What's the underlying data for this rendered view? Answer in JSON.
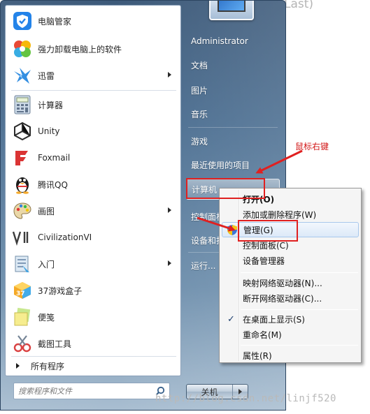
{
  "background_title": "Last)",
  "start_menu": {
    "programs": [
      {
        "label": "电脑管家",
        "icon": "pc-manager-icon",
        "submenu": false
      },
      {
        "label": "强力卸载电脑上的软件",
        "icon": "uninstaller-icon",
        "submenu": false
      },
      {
        "label": "迅雷",
        "icon": "thunder-bird-icon",
        "submenu": true
      },
      {
        "label": "计算器",
        "icon": "calculator-icon",
        "submenu": false
      },
      {
        "label": "Unity",
        "icon": "unity-icon",
        "submenu": false
      },
      {
        "label": "Foxmail",
        "icon": "foxmail-icon",
        "submenu": false
      },
      {
        "label": "腾讯QQ",
        "icon": "qq-penguin-icon",
        "submenu": false
      },
      {
        "label": "画图",
        "icon": "paint-palette-icon",
        "submenu": true
      },
      {
        "label": "CivilizationVI",
        "icon": "civilization-icon",
        "submenu": false
      },
      {
        "label": "入门",
        "icon": "getting-started-icon",
        "submenu": true
      },
      {
        "label": "37游戏盒子",
        "icon": "game-box-icon",
        "submenu": false
      },
      {
        "label": "便笺",
        "icon": "sticky-notes-icon",
        "submenu": false
      },
      {
        "label": "截图工具",
        "icon": "snipping-tool-icon",
        "submenu": false
      }
    ],
    "all_programs": "所有程序",
    "search_placeholder": "搜索程序和文件",
    "right_links": [
      {
        "label": "Administrator"
      },
      {
        "label": "文档"
      },
      {
        "label": "图片"
      },
      {
        "label": "音乐"
      },
      {
        "label": "游戏"
      },
      {
        "label": "最近使用的项目"
      },
      {
        "label": "计算机"
      },
      {
        "label": "控制面板"
      },
      {
        "label": "设备和打印机"
      },
      {
        "label": "运行..."
      }
    ],
    "shutdown_label": "关机"
  },
  "context_menu": {
    "items": [
      {
        "label": "打开(O)",
        "bold": true
      },
      {
        "label": "添加或删除程序(W)"
      },
      {
        "label": "管理(G)",
        "icon": "uac-shield-icon",
        "selected": true
      },
      {
        "label": "控制面板(C)"
      },
      {
        "label": "设备管理器"
      },
      {
        "label": "映射网络驱动器(N)..."
      },
      {
        "label": "断开网络驱动器(C)..."
      },
      {
        "label": "在桌面上显示(S)",
        "checked": true
      },
      {
        "label": "重命名(M)"
      },
      {
        "label": "属性(R)"
      }
    ]
  },
  "annotation": {
    "label": "鼠标右键",
    "color": "#e02020"
  },
  "watermark": "http://blog.csdn.net/linjf520"
}
